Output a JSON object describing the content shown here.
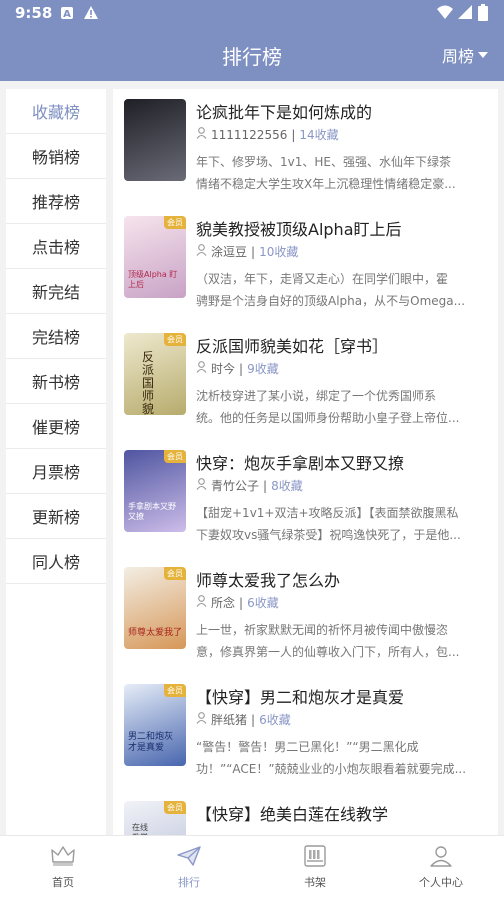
{
  "status": {
    "time": "9:58"
  },
  "header": {
    "title": "排行榜",
    "period": "周榜"
  },
  "sidebar": {
    "items": [
      {
        "label": "收藏榜",
        "active": true
      },
      {
        "label": "畅销榜"
      },
      {
        "label": "推荐榜"
      },
      {
        "label": "点击榜"
      },
      {
        "label": "新完结"
      },
      {
        "label": "完结榜"
      },
      {
        "label": "新书榜"
      },
      {
        "label": "催更榜"
      },
      {
        "label": "月票榜"
      },
      {
        "label": "更新榜"
      },
      {
        "label": "同人榜"
      }
    ]
  },
  "books": [
    {
      "title": "论疯批年下是如何炼成的",
      "author": "1111122556",
      "fav": "14收藏",
      "desc1": "年下、修罗场、1v1、HE、强强、水仙年下绿茶",
      "desc2": "情绪不稳定大学生攻X年上沉稳理性情绪稳定豪...",
      "badge": "",
      "cover_colors": [
        "#2b2b33",
        "#5a5a66"
      ]
    },
    {
      "title": "貌美教授被顶级Alpha盯上后",
      "author": "涂逗豆",
      "fav": "10收藏",
      "desc1": "（双洁，年下，走肾又走心）在同学们眼中，霍",
      "desc2": "骋野是个洁身自好的顶级Alpha，从不与Omega...",
      "badge": "会员",
      "cover_colors": [
        "#f2dde6",
        "#c9a3c4"
      ],
      "cover_text": "顶级Alpha 盯上后"
    },
    {
      "title": "反派国师貌美如花［穿书］",
      "author": "时今",
      "fav": "9收藏",
      "desc1": "沈析枝穿进了某小说，绑定了一个优秀国师系",
      "desc2": "统。他的任务是以国师身份帮助小皇子登上帝位...",
      "badge": "会员",
      "cover_colors": [
        "#e9e4c8",
        "#b9b07a"
      ],
      "cover_text": "反派国师貌美如花"
    },
    {
      "title": "快穿：炮灰手拿剧本又野又撩",
      "author": "青竹公子",
      "fav": "8收藏",
      "desc1": "【甜宠+1v1+双洁+攻略反派】【表面禁欲腹黑私",
      "desc2": "下妻奴攻vs骚气绿茶受】祝鸣逸快死了，于是他...",
      "badge": "会员",
      "cover_colors": [
        "#5b63a8",
        "#c8b8e8"
      ],
      "cover_text": "手拿剧本又野又撩"
    },
    {
      "title": "师尊太爱我了怎么办",
      "author": "所念",
      "fav": "6收藏",
      "desc1": "上一世，祈家默默无闻的祈怀月被传闻中傲慢恣",
      "desc2": "意，修真界第一人的仙尊收入门下，所有人，包...",
      "badge": "会员",
      "cover_colors": [
        "#f4efe6",
        "#d9a06a"
      ],
      "cover_text": "师尊太爱我了"
    },
    {
      "title": "【快穿】男二和炮灰才是真爱",
      "author": "胖纸猪",
      "fav": "6收藏",
      "desc1": "“警告！警告！男二已黑化！”“男二黑化成",
      "desc2": "功！”“ACE！”兢兢业业的小炮灰眼看着就要完成...",
      "badge": "会员",
      "cover_colors": [
        "#e8eef7",
        "#4a6ab0"
      ],
      "cover_text": "男二和炮灰 才是真爱"
    },
    {
      "title": "【快穿】绝美白莲在线教学",
      "author": "",
      "fav": "",
      "desc1": "",
      "desc2": "",
      "badge": "会员",
      "cover_colors": [
        "#eef0f6",
        "#b8c0d8"
      ],
      "cover_text": "在线教学"
    }
  ],
  "nav": [
    {
      "label": "首页",
      "icon": "crown-icon"
    },
    {
      "label": "排行",
      "icon": "paper-plane-icon",
      "active": true
    },
    {
      "label": "书架",
      "icon": "bookshelf-icon"
    },
    {
      "label": "个人中心",
      "icon": "person-icon"
    }
  ]
}
